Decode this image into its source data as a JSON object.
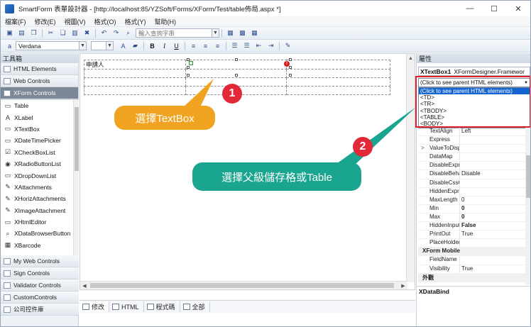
{
  "window": {
    "title": "SmartForm 表單設計器 - [http://localhost:85/YZSoft/Forms/XForm/Test/table佈局.aspx *]",
    "minimize": "—",
    "maximize": "☐",
    "close": "✕"
  },
  "menu": [
    "檔案(F)",
    "修改(E)",
    "視圖(V)",
    "格式(O)",
    "格式(Y)",
    "幫助(H)"
  ],
  "toolbar": {
    "search_placeholder": "輸入查詢字串",
    "font_name": "Verdana",
    "bold": "B",
    "italic": "I",
    "underline": "U"
  },
  "toolbox": {
    "title": "工具箱",
    "top_groups": [
      "HTML Elements",
      "Web Controls",
      "XForm Controls"
    ],
    "items": [
      {
        "icon": "▭",
        "label": "Table"
      },
      {
        "icon": "A",
        "label": "XLabel"
      },
      {
        "icon": "▭",
        "label": "XTextBox"
      },
      {
        "icon": "▭",
        "label": "XDateTimePicker"
      },
      {
        "icon": "☑",
        "label": "XCheckBoxList"
      },
      {
        "icon": "◉",
        "label": "XRadioButtonList"
      },
      {
        "icon": "▭",
        "label": "XDropDownList"
      },
      {
        "icon": "✎",
        "label": "XAttachments"
      },
      {
        "icon": "✎",
        "label": "XHorizAttachments"
      },
      {
        "icon": "✎",
        "label": "XImageAttachment"
      },
      {
        "icon": "▭",
        "label": "XHtmlEditor"
      },
      {
        "icon": "⌕",
        "label": "XDataBrowserButton"
      },
      {
        "icon": "▦",
        "label": "XBarcode"
      }
    ],
    "bottom_groups": [
      "My Web Controls",
      "Sign Controls",
      "Validator Controls",
      "CustomControls",
      "公司控件庫"
    ]
  },
  "canvas": {
    "cell_label": "申請人"
  },
  "view_tabs": [
    "修改",
    "HTML",
    "程式碼",
    "全部"
  ],
  "callouts": {
    "step1_number": "1",
    "step1_text": "選擇TextBox",
    "step2_number": "2",
    "step2_text": "選擇父級儲存格或Table"
  },
  "properties": {
    "title": "屬性",
    "object_name": "XTextBox1",
    "object_type": "XFormDesigner.Framewor",
    "parent_select_value": "(Click to see parent HTML elements)",
    "parent_options": [
      "(Click to see parent HTML elements)",
      "<TD>",
      "<TR>",
      "<TBODY>",
      "<TABLE>",
      "<BODY>"
    ],
    "rows": [
      {
        "key": "TextAlign",
        "value": "Left"
      },
      {
        "key": "Express",
        "value": ""
      },
      {
        "key": "ValueToDisplay",
        "value": "",
        "expand": ">"
      },
      {
        "key": "DataMap",
        "value": ""
      },
      {
        "key": "DisableExpress",
        "value": ""
      },
      {
        "key": "DisableBehavio",
        "value": "Disable"
      },
      {
        "key": "DisableCssClass",
        "value": ""
      },
      {
        "key": "HiddenExpress",
        "value": ""
      },
      {
        "key": "MaxLength",
        "value": "0"
      },
      {
        "key": "Min",
        "value": "0",
        "bold": true
      },
      {
        "key": "Max",
        "value": "0",
        "bold": true
      },
      {
        "key": "HiddenInput",
        "value": "False",
        "bold": true
      },
      {
        "key": "PrintOut",
        "value": "True"
      },
      {
        "key": "PlaceHolder",
        "value": ""
      }
    ],
    "category_mobile": "XForm Mobile",
    "mobile_rows": [
      {
        "key": "FieldName",
        "value": ""
      },
      {
        "key": "Visibility",
        "value": "True"
      }
    ],
    "category_appearance": "外觀",
    "description_title": "XDataBind"
  }
}
